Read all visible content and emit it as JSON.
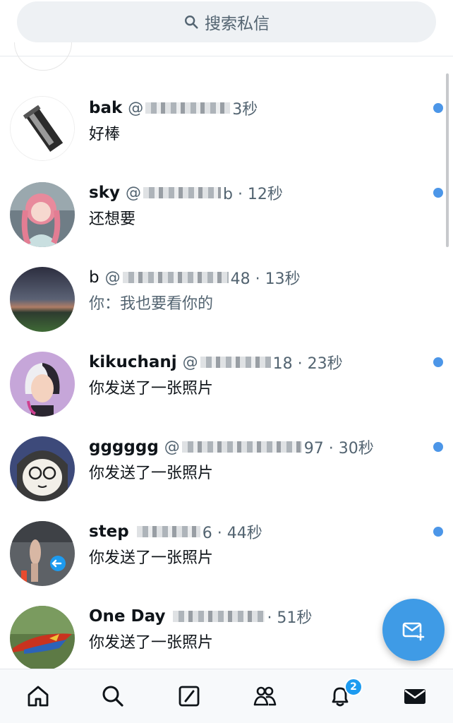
{
  "search": {
    "placeholder": "搜索私信"
  },
  "conversations": [
    {
      "name": "bak",
      "handle": "@",
      "time": "3秒",
      "preview": "好棒",
      "unread": true,
      "bold": true
    },
    {
      "name": "sky",
      "handle": "@",
      "time": "b · 12秒",
      "preview": "还想要",
      "unread": true,
      "bold": true
    },
    {
      "name": "b",
      "handle": "@",
      "time": "48 · 13秒",
      "preview": "你：我也要看你的",
      "unread": false,
      "bold": false
    },
    {
      "name": "kikuchanj",
      "handle": "@",
      "time": "18 · 23秒",
      "preview": "你发送了一张照片",
      "unread": true,
      "bold": true
    },
    {
      "name": "gggggg",
      "handle": "@",
      "time": "97 · 30秒",
      "preview": "你发送了一张照片",
      "unread": true,
      "bold": true
    },
    {
      "name": "step",
      "handle": "",
      "time": "6 · 44秒",
      "preview": "你发送了一张照片",
      "unread": true,
      "bold": true
    },
    {
      "name": "One Day",
      "handle": "",
      "time": "· 51秒",
      "preview": "你发送了一张照片",
      "unread": false,
      "bold": true
    }
  ],
  "tabs": [
    {
      "name": "home",
      "icon": "home-icon"
    },
    {
      "name": "search",
      "icon": "search-icon"
    },
    {
      "name": "grok",
      "icon": "slash-box-icon"
    },
    {
      "name": "communities",
      "icon": "people-icon"
    },
    {
      "name": "notifications",
      "icon": "bell-icon",
      "badge": "2"
    },
    {
      "name": "messages",
      "icon": "envelope-icon"
    }
  ],
  "colors": {
    "accent": "#1d9bf0",
    "unread_dot": "#4c96e8",
    "secondary_text": "#536471"
  }
}
